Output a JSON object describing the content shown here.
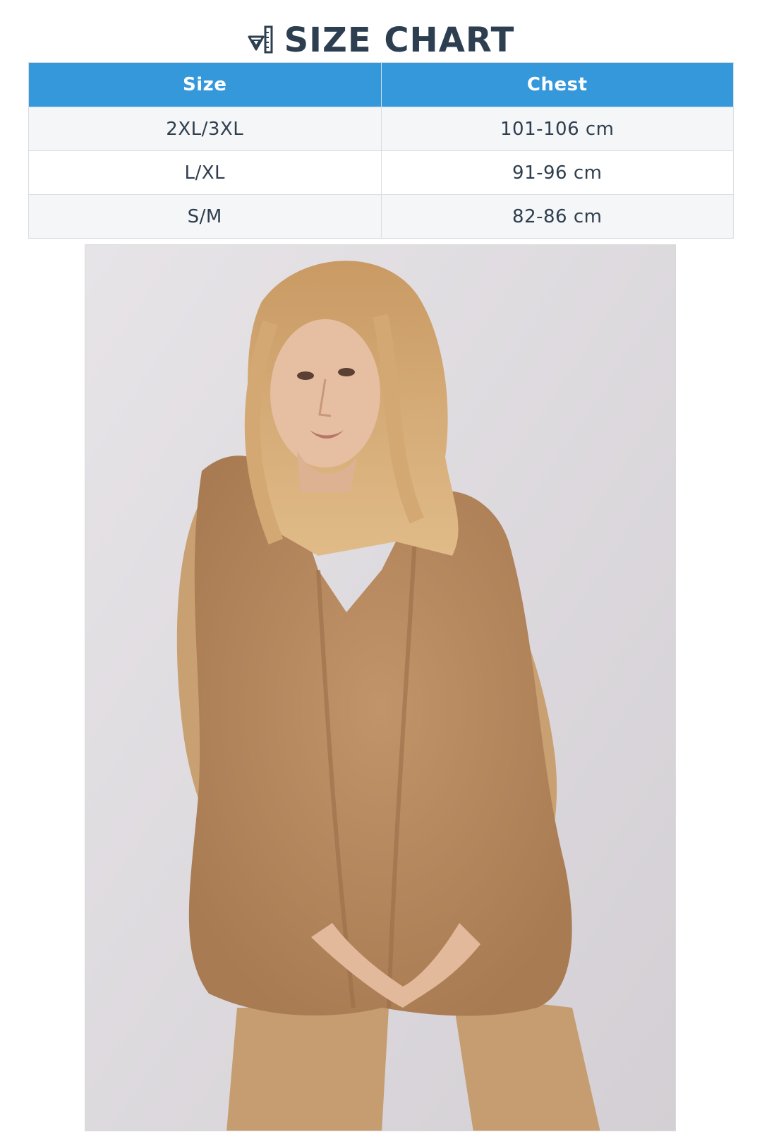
{
  "header": {
    "title": "SIZE CHART",
    "icon": "ruler-triangle-icon"
  },
  "size_table": {
    "columns": [
      "Size",
      "Chest"
    ],
    "rows": [
      {
        "size": "2XL/3XL",
        "chest": "101-106 cm"
      },
      {
        "size": "L/XL",
        "chest": "91-96 cm"
      },
      {
        "size": "S/M",
        "chest": "82-86 cm"
      }
    ]
  },
  "colors": {
    "title": "#2c3e50",
    "table_header": "#3498db",
    "row_alt": "#f4f6f8",
    "vest": "#b88a5e",
    "sweater": "#c9a071"
  },
  "photo": {
    "subject": "product-photo"
  }
}
